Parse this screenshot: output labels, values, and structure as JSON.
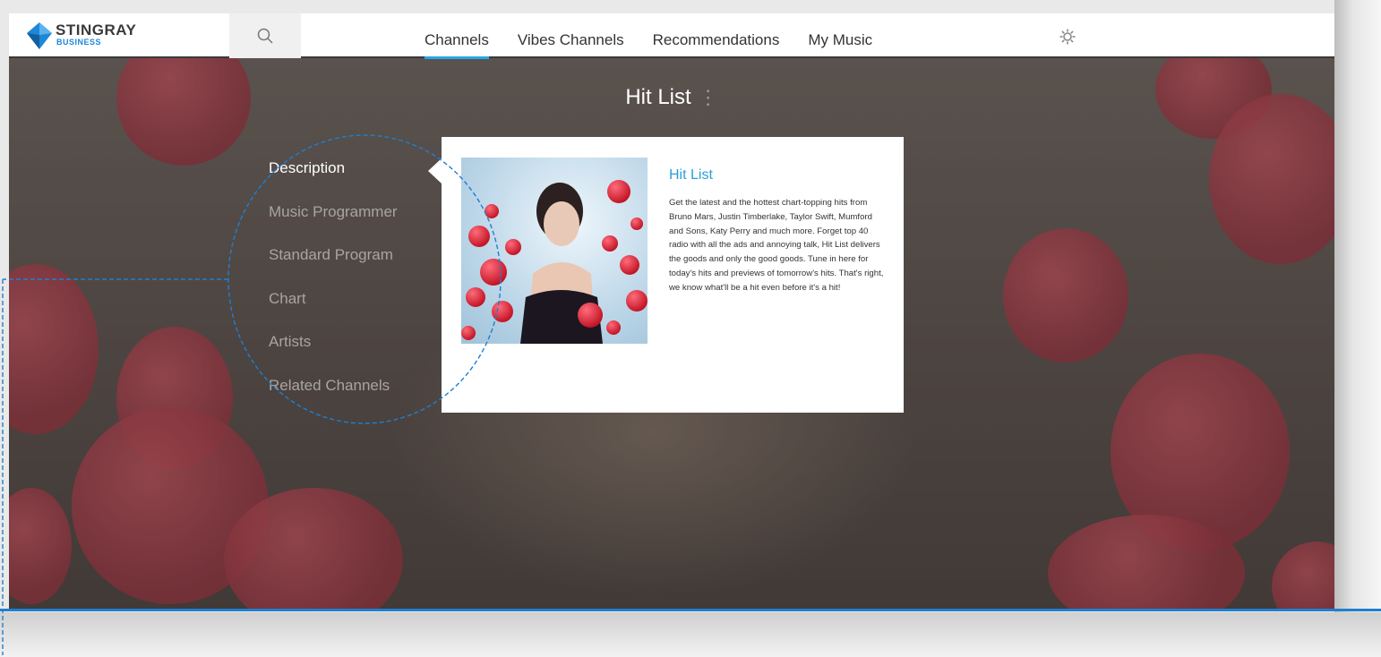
{
  "brand": {
    "name": "STINGRAY",
    "sub": "BUSINESS"
  },
  "nav": {
    "items": [
      "Channels",
      "Vibes Channels",
      "Recommendations",
      "My Music"
    ],
    "active": "Channels"
  },
  "page": {
    "title": "Hit List"
  },
  "side_menu": {
    "items": [
      "Description",
      "Music Programmer",
      "Standard Program",
      "Chart",
      "Artists",
      "Related Channels"
    ],
    "active": "Description"
  },
  "card": {
    "title": "Hit List",
    "description": "Get the latest and the hottest chart-topping hits from Bruno Mars, Justin Timberlake, Taylor Swift, Mumford and Sons, Katy Perry and much more. Forget top 40 radio with all the ads and annoying talk, Hit List delivers the goods and only the good goods. Tune in here for today's hits and previews of tomorrow's hits. That's right, we know what'll be a hit even before it's a hit!"
  },
  "colors": {
    "accent": "#28a6e6",
    "annotation": "#1f7fd0",
    "card_title": "#2aa0d8"
  },
  "icons": {
    "search": "search-icon",
    "settings": "gear-icon",
    "more": "vertical-dots-icon"
  }
}
